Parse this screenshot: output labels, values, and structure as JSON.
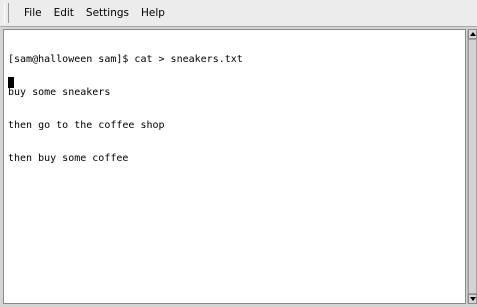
{
  "menu": {
    "file": "File",
    "edit": "Edit",
    "settings": "Settings",
    "help": "Help"
  },
  "terminal": {
    "lines": [
      "[sam@halloween sam]$ cat > sneakers.txt",
      "buy some sneakers",
      "then go to the coffee shop",
      "then buy some coffee"
    ]
  },
  "icons": {
    "scroll_up": "triangle-up",
    "scroll_down": "triangle-down"
  }
}
